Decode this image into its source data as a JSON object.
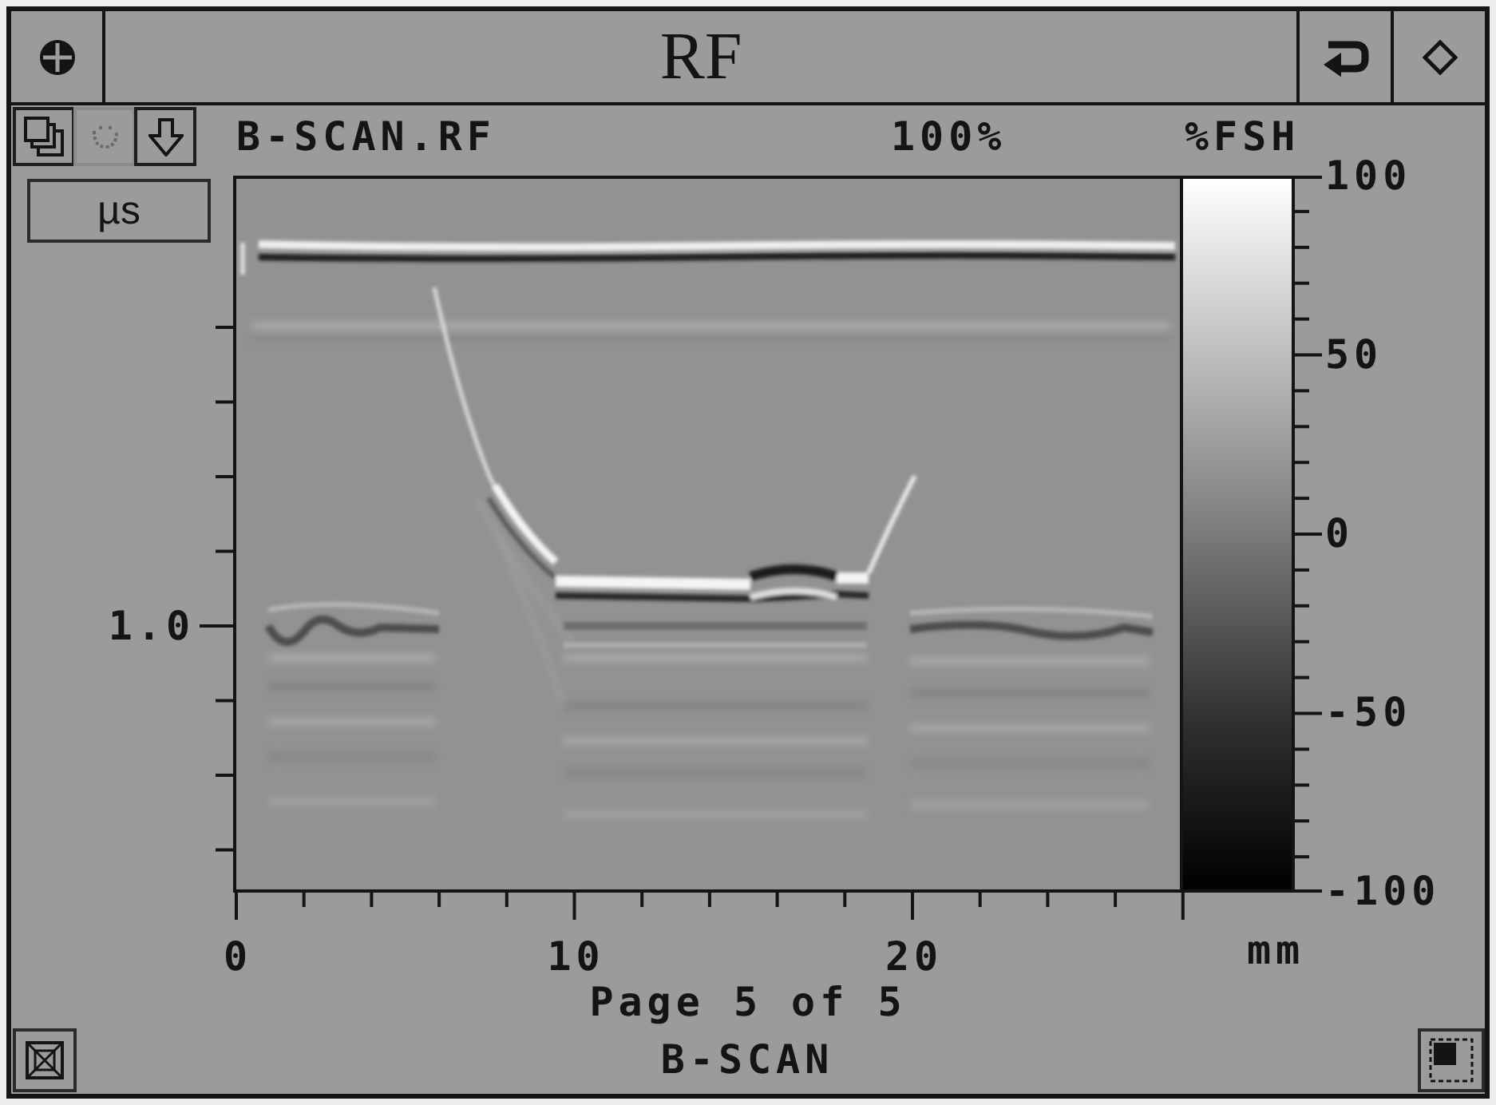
{
  "title_bar": {
    "title": "RF"
  },
  "toolbar": {
    "buttons": [
      {
        "kind": "layers",
        "disabled": false
      },
      {
        "kind": "curve",
        "disabled": true
      },
      {
        "kind": "arrow_down",
        "disabled": false
      }
    ],
    "file_name": "B-SCAN.RF",
    "zoom": "100%",
    "amplitude_unit": "%FSH"
  },
  "y_axis": {
    "unit_button": "µs",
    "tick_labels": [
      "1.0"
    ]
  },
  "color_scale": {
    "tick_labels": [
      "100",
      "50",
      "0",
      "-50",
      "-100"
    ]
  },
  "x_axis": {
    "tick_labels": [
      "0",
      "10",
      "20"
    ],
    "unit": "mm"
  },
  "footer": {
    "page_indicator": "Page 5 of 5",
    "view_name": "B-SCAN"
  }
}
